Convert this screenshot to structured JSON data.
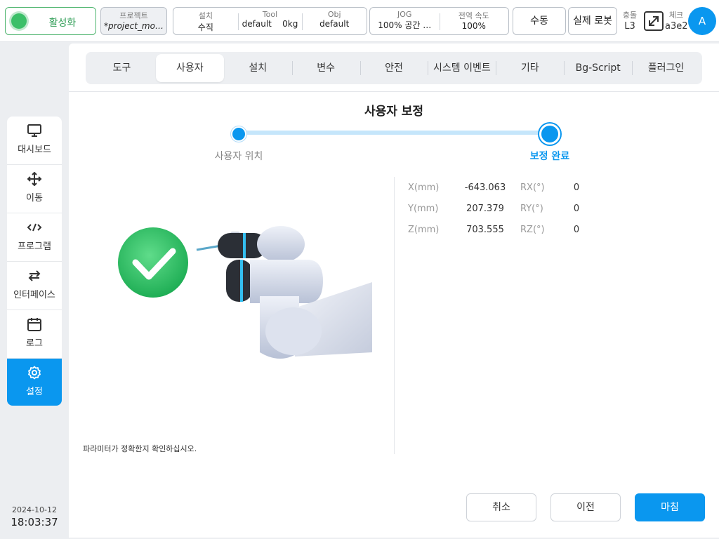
{
  "topbar": {
    "enable_label": "활성화",
    "project_head": "프로젝트",
    "project_value": "*project_mo…",
    "install_head": "설치",
    "install_value": "수직",
    "tool_head": "Tool",
    "tool_value": "default",
    "tool_weight": "0kg",
    "obj_head": "Obj",
    "obj_value": "default",
    "jog_head": "JOG",
    "jog_value": "100%  공간 …",
    "speed_head": "전역 속도",
    "speed_value": "100%",
    "manual_label": "수동",
    "real_robot_label": "실제 로봇",
    "collision_head": "충돌",
    "collision_value": "L3",
    "check_head": "체크",
    "check_value": "a3e2",
    "avatar_letter": "A"
  },
  "sidebar": {
    "items": [
      {
        "label": "대시보드",
        "icon": "monitor-icon"
      },
      {
        "label": "이동",
        "icon": "move-arrows-icon"
      },
      {
        "label": "프로그램",
        "icon": "code-icon"
      },
      {
        "label": "인터페이스",
        "icon": "swap-arrows-icon"
      },
      {
        "label": "로그",
        "icon": "calendar-icon"
      },
      {
        "label": "설정",
        "icon": "gear-icon"
      }
    ],
    "active": "설정",
    "date": "2024-10-12",
    "time": "18:03:37"
  },
  "tabs": [
    "도구",
    "사용자",
    "설치",
    "변수",
    "안전",
    "시스템 이벤트",
    "기타",
    "Bg-Script",
    "플러그인"
  ],
  "active_tab": "사용자",
  "calibration": {
    "title": "사용자 보정",
    "step1": "사용자 위치",
    "step2": "보정 완료",
    "coords": [
      {
        "l1": "X(mm)",
        "v1": "-643.063",
        "l2": "RX(°)",
        "v2": "0"
      },
      {
        "l1": "Y(mm)",
        "v1": "207.379",
        "l2": "RY(°)",
        "v2": "0"
      },
      {
        "l1": "Z(mm)",
        "v1": "703.555",
        "l2": "RZ(°)",
        "v2": "0"
      }
    ],
    "hint": "파라미터가 정확한지 확인하십시오."
  },
  "buttons": {
    "cancel": "취소",
    "prev": "이전",
    "finish": "마침"
  },
  "colors": {
    "accent": "#0a97ef",
    "enable_green": "#3bbf68"
  }
}
